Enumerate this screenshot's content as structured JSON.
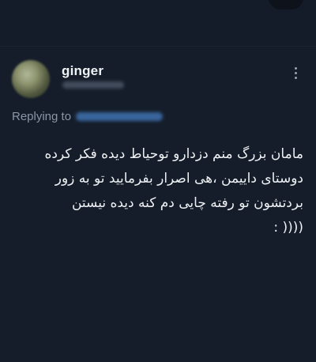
{
  "tweet": {
    "display_name": "ginger",
    "replying_to_label": "Replying to",
    "text_lines": [
      "مامان بزرگ منم دزدارو توحیاط دیده فکر کرده",
      "دوستای داییمن ،هی اصرار بفرمایید تو به زور",
      "بردتشون تو رفته چایی دم کنه دیده نیستن",
      "(((( :"
    ]
  },
  "icons": {
    "more": "more-vertical-icon"
  },
  "colors": {
    "background": "#141c29",
    "primary_text": "#eef1f4",
    "secondary_text": "#8a95a5",
    "mention": "#3d6ea9"
  }
}
